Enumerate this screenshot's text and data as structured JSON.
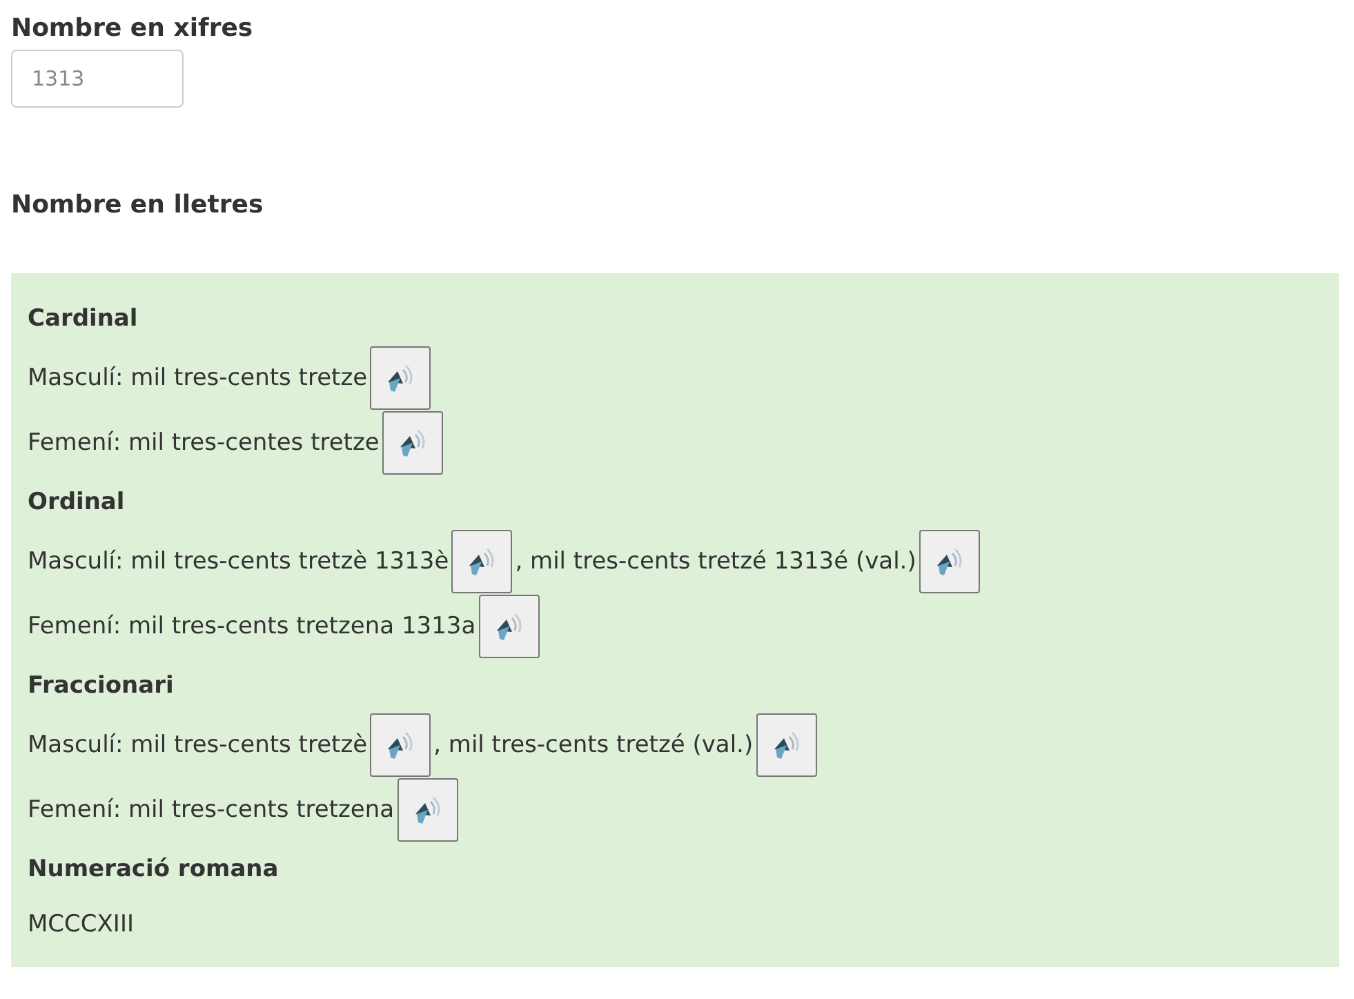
{
  "number_field": {
    "label": "Nombre en xifres",
    "placeholder": "1313"
  },
  "result_title": "Nombre en lletres",
  "sections": [
    {
      "heading": "Cardinal",
      "lines": [
        {
          "parts": [
            {
              "kind": "text",
              "text": "Masculí: mil tres-cents tretze"
            },
            {
              "kind": "speaker"
            }
          ]
        },
        {
          "parts": [
            {
              "kind": "text",
              "text": "Femení: mil tres-centes tretze"
            },
            {
              "kind": "speaker"
            }
          ]
        }
      ]
    },
    {
      "heading": "Ordinal",
      "lines": [
        {
          "parts": [
            {
              "kind": "text",
              "text": "Masculí: mil tres-cents tretzè 1313è"
            },
            {
              "kind": "speaker"
            },
            {
              "kind": "text",
              "text": ", mil tres-cents tretzé 1313é (val.)"
            },
            {
              "kind": "speaker"
            }
          ]
        },
        {
          "parts": [
            {
              "kind": "text",
              "text": "Femení: mil tres-cents tretzena 1313a"
            },
            {
              "kind": "speaker"
            }
          ]
        }
      ]
    },
    {
      "heading": "Fraccionari",
      "lines": [
        {
          "parts": [
            {
              "kind": "text",
              "text": "Masculí: mil tres-cents tretzè"
            },
            {
              "kind": "speaker"
            },
            {
              "kind": "text",
              "text": ", mil tres-cents tretzé (val.)"
            },
            {
              "kind": "speaker"
            }
          ]
        },
        {
          "parts": [
            {
              "kind": "text",
              "text": "Femení: mil tres-cents tretzena"
            },
            {
              "kind": "speaker"
            }
          ]
        }
      ]
    },
    {
      "heading": "Numeració romana",
      "lines": [
        {
          "parts": [
            {
              "kind": "text",
              "text": "MCCCXIII"
            }
          ]
        }
      ]
    }
  ]
}
